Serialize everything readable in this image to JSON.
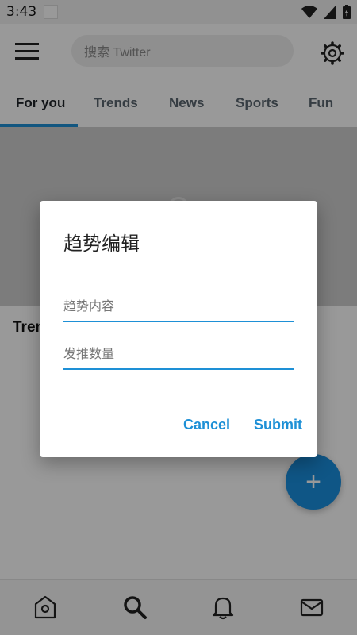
{
  "status_bar": {
    "time": "3:43",
    "icons": [
      "wifi-icon",
      "signal-icon",
      "battery-icon"
    ]
  },
  "app_bar": {
    "menu_icon": "hamburger-icon",
    "search_placeholder": "搜索 Twitter",
    "settings_icon": "gear-icon"
  },
  "tabs": [
    {
      "label": "For you",
      "active": true
    },
    {
      "label": "Trends",
      "active": false
    },
    {
      "label": "News",
      "active": false
    },
    {
      "label": "Sports",
      "active": false
    },
    {
      "label": "Fun",
      "active": false
    }
  ],
  "content": {
    "trends_heading": "Tren"
  },
  "fab": {
    "icon": "plus-icon",
    "label": "+"
  },
  "bottom_nav": {
    "items": [
      "home-icon",
      "search-icon",
      "notifications-icon",
      "messages-icon"
    ]
  },
  "dialog": {
    "title": "趋势编辑",
    "field_content_placeholder": "趋势内容",
    "field_count_placeholder": "发推数量",
    "cancel_label": "Cancel",
    "submit_label": "Submit"
  },
  "colors": {
    "accent": "#1e90d6",
    "fab": "#1a8fe0",
    "scrim": "#000000"
  }
}
